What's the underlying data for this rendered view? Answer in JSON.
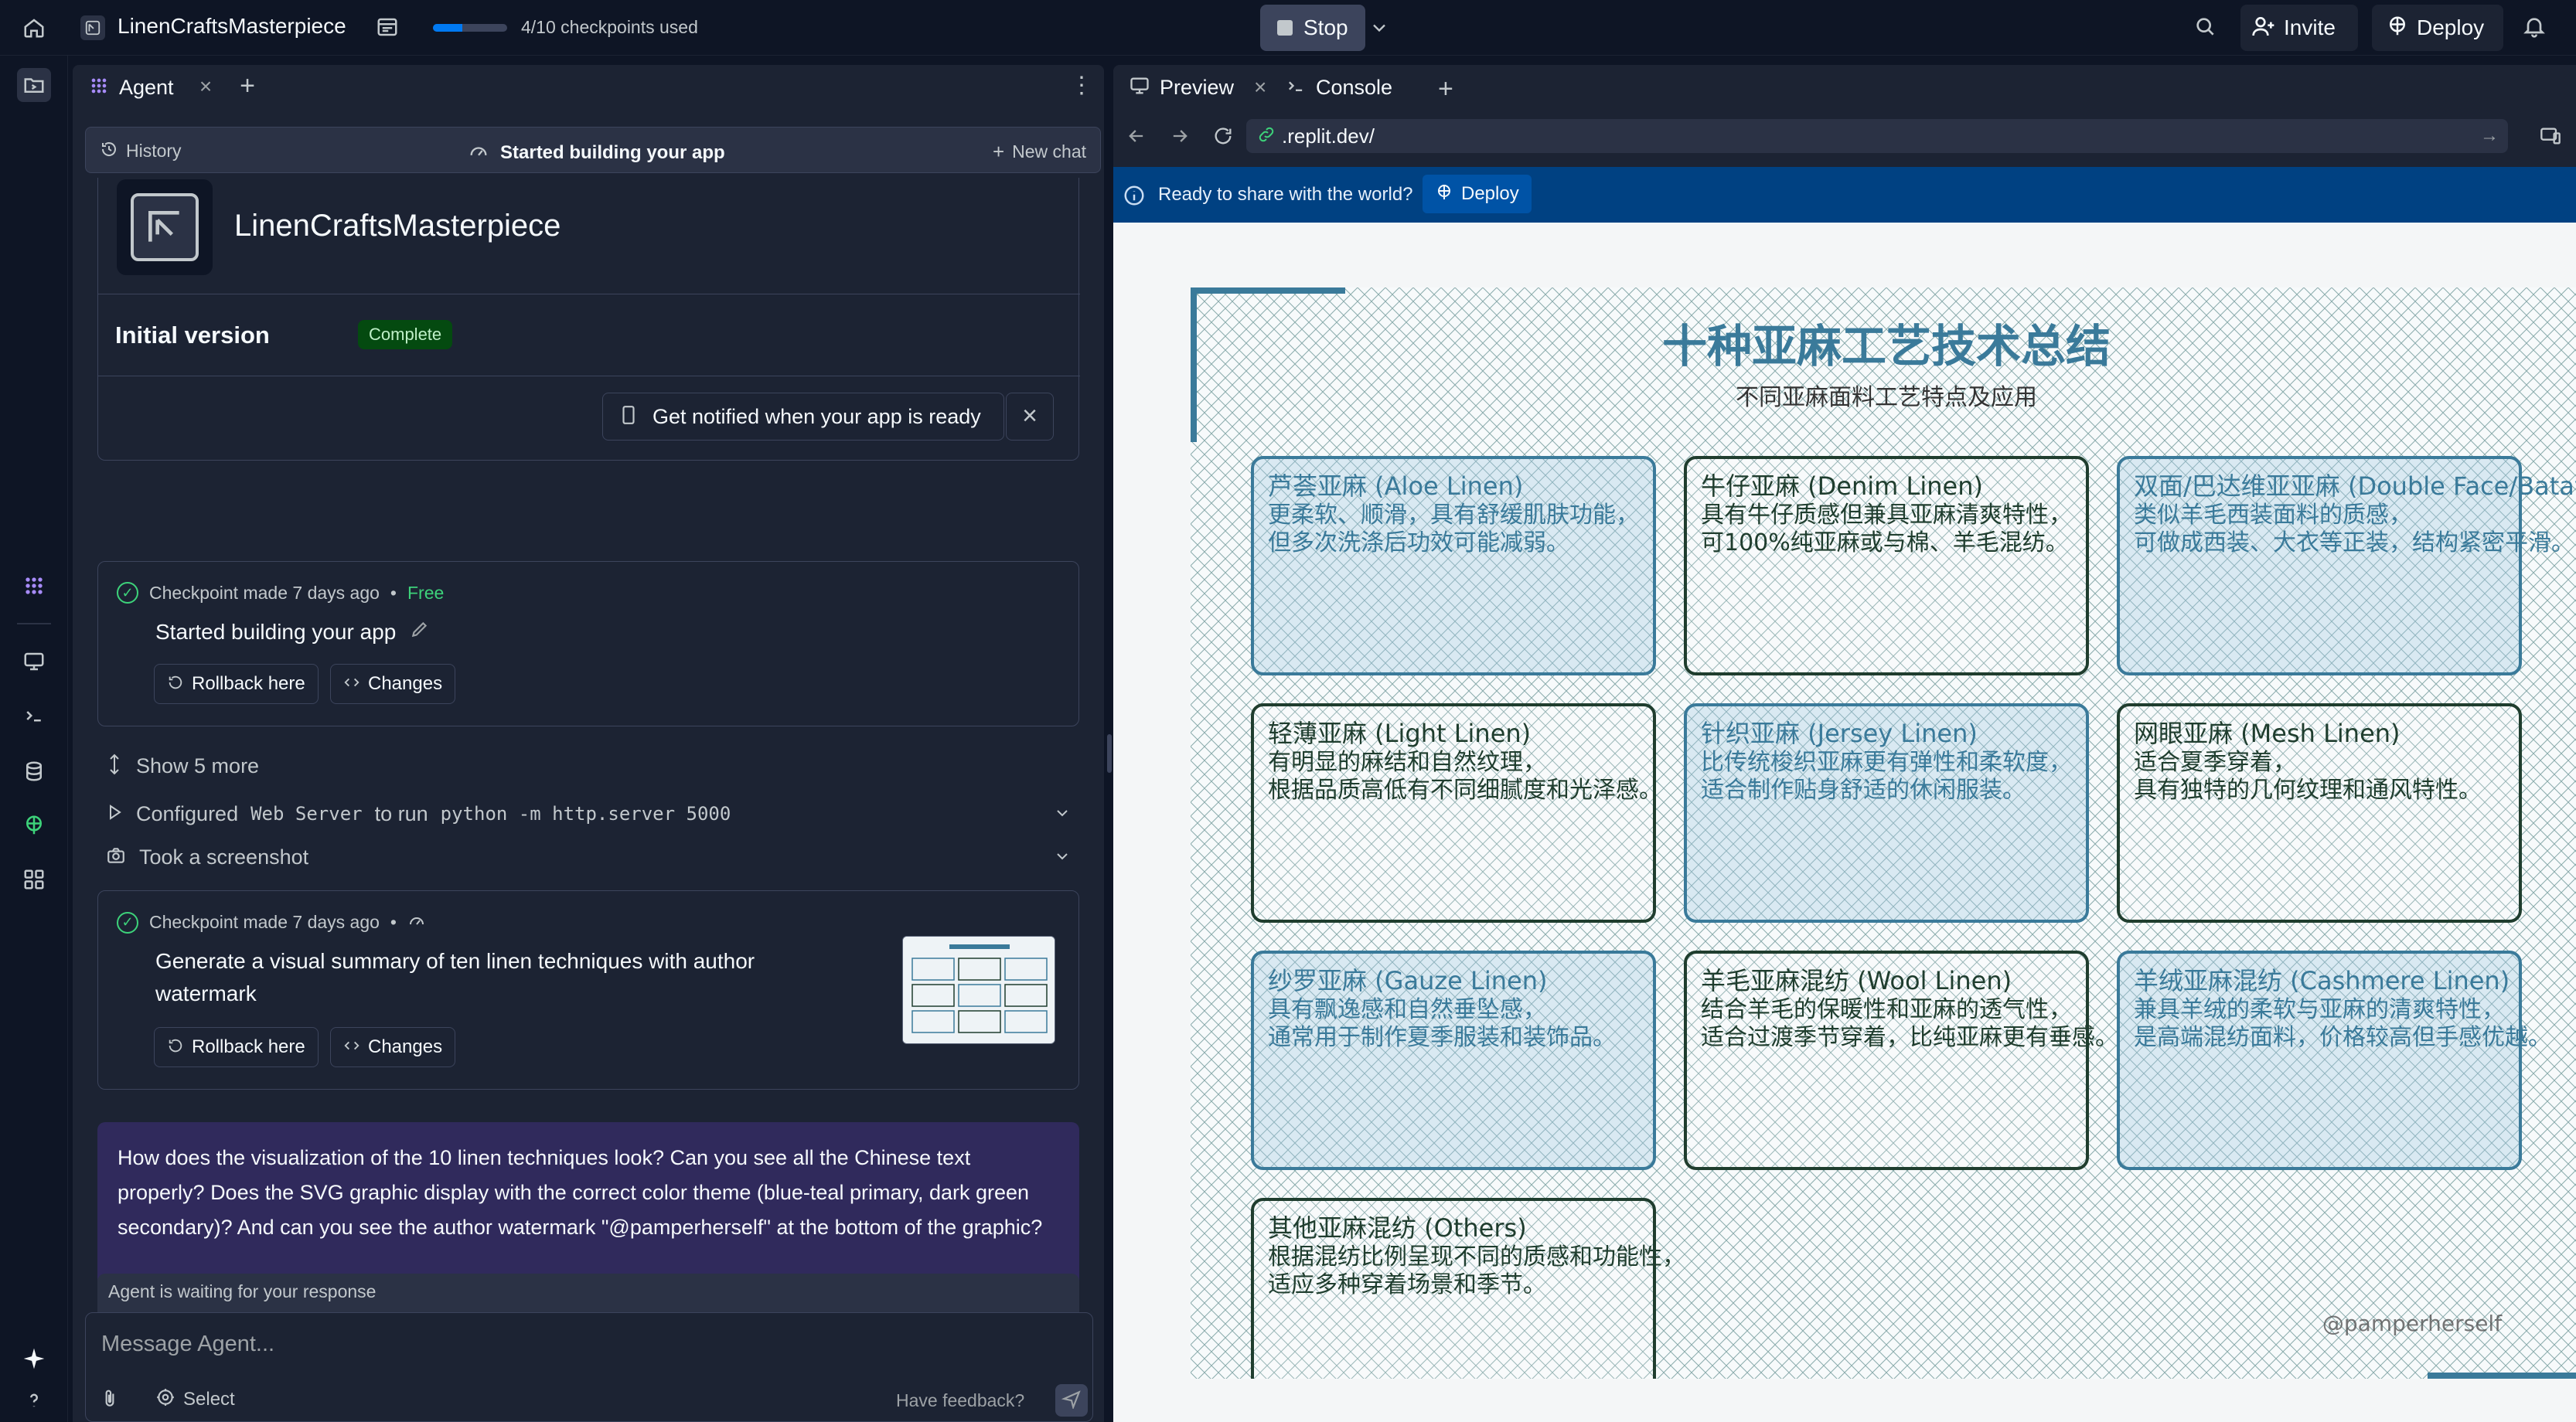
{
  "topbar": {
    "project_name": "LinenCraftsMasterpiece",
    "checkpoints_text": "4/10 checkpoints used",
    "checkpoints_fraction": 0.4,
    "stop_label": "Stop",
    "invite_label": "Invite",
    "deploy_label": "Deploy"
  },
  "agent": {
    "tab_label": "Agent",
    "history_label": "History",
    "header_title": "Started building your app",
    "new_chat_label": "New chat",
    "app_card": {
      "name": "LinenCraftsMasterpiece",
      "version_label": "Initial version",
      "status_badge": "Complete",
      "notify_label": "Get notified when your app is ready"
    },
    "checkpoint1": {
      "meta": "Checkpoint made 7 days ago",
      "price": "Free",
      "title": "Started building your app",
      "rollback_label": "Rollback here",
      "changes_label": "Changes"
    },
    "show_more_label": "Show 5 more",
    "configured": {
      "prefix": "Configured",
      "server": "Web Server",
      "middle": "to run",
      "command": "python -m http.server 5000"
    },
    "screenshot_label": "Took a screenshot",
    "checkpoint2": {
      "meta": "Checkpoint made 7 days ago",
      "title": "Generate a visual summary of ten linen techniques with author watermark",
      "rollback_label": "Rollback here",
      "changes_label": "Changes"
    },
    "user_message": "How does the visualization of the 10 linen techniques look? Can you see all the Chinese text properly? Does the SVG graphic display with the correct color theme (blue-teal primary, dark green secondary)? And can you see the author watermark \"@pamperherself\" at the bottom of the graphic?",
    "waiting_label": "Agent is waiting for your response",
    "composer_placeholder": "Message Agent...",
    "select_label": "Select",
    "feedback_label": "Have feedback?"
  },
  "preview": {
    "tab_preview": "Preview",
    "tab_console": "Console",
    "url": ".replit.dev/",
    "banner_text": "Ready to share with the world?",
    "banner_deploy_label": "Deploy",
    "graphic": {
      "title": "十种亚麻工艺技术总结",
      "subtitle": "不同亚麻面料工艺特点及应用",
      "watermark": "@pamperherself",
      "colors": {
        "primary": "#3a7a9a",
        "secondary": "#1f3d2e"
      },
      "cards": [
        {
          "title": "芦荟亚麻 (Aloe Linen)",
          "line1": "更柔软、顺滑，具有舒缓肌肤功能，",
          "line2": "但多次洗涤后功效可能减弱。",
          "style": "primary"
        },
        {
          "title": "牛仔亚麻 (Denim Linen)",
          "line1": "具有牛仔质感但兼具亚麻清爽特性，",
          "line2": "可100%纯亚麻或与棉、羊毛混纺。",
          "style": "secondary"
        },
        {
          "title": "双面/巴达维亚亚麻 (Double Face/Batavia Linen)",
          "line1": "类似羊毛西装面料的质感，",
          "line2": "可做成西装、大衣等正装，结构紧密平滑。",
          "style": "primary"
        },
        {
          "title": "轻薄亚麻 (Light Linen)",
          "line1": "有明显的麻结和自然纹理，",
          "line2": "根据品质高低有不同细腻度和光泽感。",
          "style": "secondary"
        },
        {
          "title": "针织亚麻 (Jersey Linen)",
          "line1": "比传统梭织亚麻更有弹性和柔软度，",
          "line2": "适合制作贴身舒适的休闲服装。",
          "style": "primary"
        },
        {
          "title": "网眼亚麻 (Mesh Linen)",
          "line1": "适合夏季穿着，",
          "line2": "具有独特的几何纹理和通风特性。",
          "style": "secondary"
        },
        {
          "title": "纱罗亚麻 (Gauze Linen)",
          "line1": "具有飘逸感和自然垂坠感，",
          "line2": "通常用于制作夏季服装和装饰品。",
          "style": "primary"
        },
        {
          "title": "羊毛亚麻混纺 (Wool Linen)",
          "line1": "结合羊毛的保暖性和亚麻的透气性，",
          "line2": "适合过渡季节穿着，比纯亚麻更有垂感。",
          "style": "secondary"
        },
        {
          "title": "羊绒亚麻混纺 (Cashmere Linen)",
          "line1": "兼具羊绒的柔软与亚麻的清爽特性，",
          "line2": "是高端混纺面料，价格较高但手感优越。",
          "style": "primary"
        },
        {
          "title": "其他亚麻混纺 (Others)",
          "line1": "根据混纺比例呈现不同的质感和功能性，",
          "line2": "适应多种穿着场景和季节。",
          "style": "secondary"
        }
      ]
    }
  }
}
